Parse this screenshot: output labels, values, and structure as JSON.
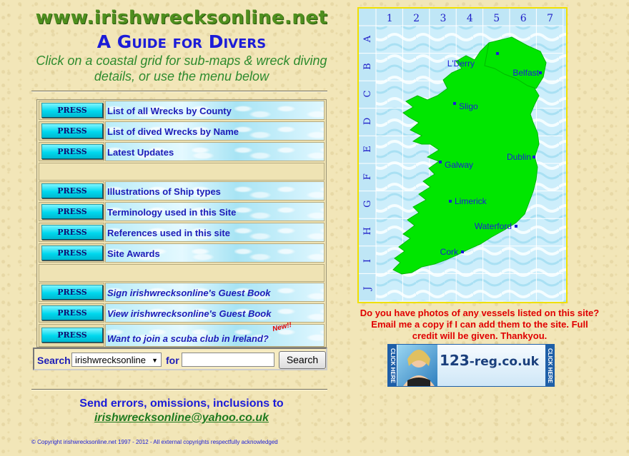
{
  "header": {
    "site_title": "www.irishwrecksonline.net",
    "guide_title": "A Guide for Divers",
    "instructions": "Click on a coastal grid for sub-maps & wreck diving details, or use the menu below"
  },
  "menu": {
    "press_label": "PRESS",
    "items": [
      {
        "label": "List of all Wrecks by County"
      },
      {
        "label": "List of dived Wrecks by Name"
      },
      {
        "label": "Latest Updates"
      },
      {
        "label": "Illustrations of Ship types"
      },
      {
        "label": "Terminology used in this Site"
      },
      {
        "label": "References used in this site"
      },
      {
        "label": "Site Awards"
      },
      {
        "label": "Sign irishwrecksonline's Guest Book"
      },
      {
        "label": "View irishwrecksonline's Guest Book"
      },
      {
        "label": "Want to join a scuba club in Ireland?"
      }
    ],
    "new_badge": "New!!"
  },
  "search": {
    "label": "Search",
    "selected_site": "irishwrecksonline",
    "for_label": "for",
    "query": "",
    "button_label": "Search"
  },
  "footer": {
    "send_text": "Send errors, omissions, inclusions to",
    "email": "irishwrecksonline@yahoo.co.uk",
    "copyright": "© Copyright irishwrecksonline.net 1997 - 2012 - All external copyrights respectfully acknowledged"
  },
  "map": {
    "columns": [
      "1",
      "2",
      "3",
      "4",
      "5",
      "6",
      "7"
    ],
    "rows": [
      "A",
      "B",
      "C",
      "D",
      "E",
      "F",
      "G",
      "H",
      "I",
      "J"
    ],
    "cities": [
      "L'Derry",
      "Belfast",
      "Sligo",
      "Dublin",
      "Galway",
      "Limerick",
      "Waterford",
      "Cork"
    ],
    "land_color": "#00e600",
    "sea_color": "#cdeefb",
    "frame_color": "#f0e000"
  },
  "photos_notice": "Do you have photos of any vessels listed on this site? Email me a copy if I can add them to the site. Full credit will be given. Thankyou.",
  "banner": {
    "side_text": "CLICK HERE",
    "logo_digits": "123",
    "logo_text": "-reg.co.uk"
  },
  "colors": {
    "background": "#f2e6b8",
    "title_green": "#4f8f1e",
    "link_blue": "#1c1cd8",
    "alert_red": "#e00000"
  }
}
